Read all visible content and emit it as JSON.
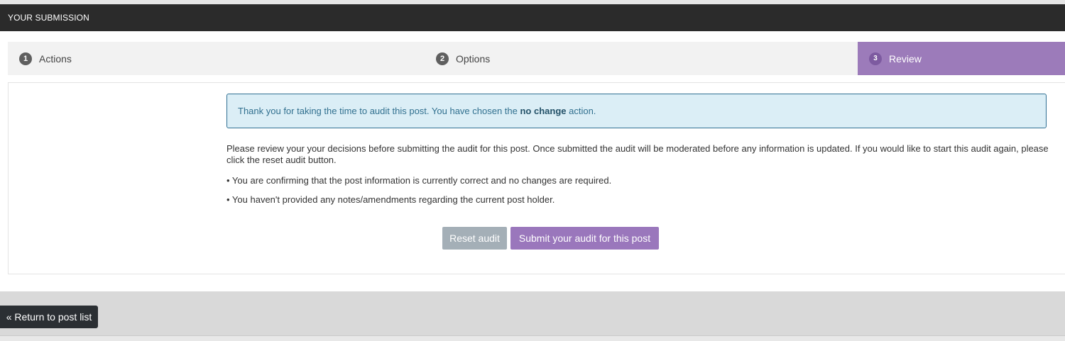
{
  "header": {
    "title": "YOUR SUBMISSION"
  },
  "steps": [
    {
      "number": "1",
      "label": "Actions",
      "active": false
    },
    {
      "number": "2",
      "label": "Options",
      "active": false
    },
    {
      "number": "3",
      "label": "Review",
      "active": true
    }
  ],
  "alert": {
    "text_before": "Thank you for taking the time to audit this post. You have chosen the ",
    "highlight": "no change",
    "text_after": " action."
  },
  "review": {
    "paragraph": "Please review your your decisions before submitting the audit for this post. Once submitted the audit will be moderated before any information is updated. If you would like to start this audit again, please click the reset audit button.",
    "bullets": [
      "• You are confirming that the post information is currently correct and no changes are required.",
      "• You haven't provided any notes/amendments regarding the current post holder."
    ]
  },
  "buttons": {
    "reset_label": "Reset audit",
    "submit_label": "Submit your audit for this post"
  },
  "footer": {
    "return_label": "« Return to post list"
  },
  "colors": {
    "header_bg": "#2b2b2b",
    "accent_purple": "#9c7bba",
    "alert_bg": "#dbeef6",
    "alert_border": "#2f6f93",
    "reset_button": "#a4afb7"
  },
  "icons": {
    "step_badge": "numbered-circle"
  }
}
